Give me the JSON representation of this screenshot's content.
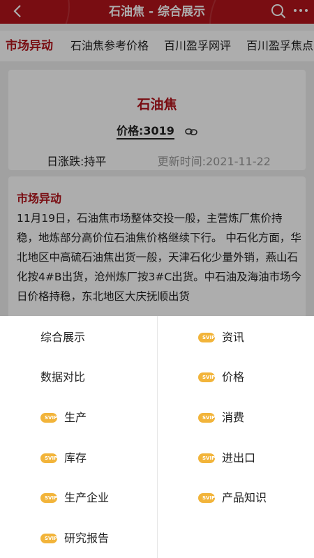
{
  "header": {
    "title": "石油焦 - 综合展示",
    "back_icon": "chevron-left-icon",
    "search_icon": "search-icon",
    "more_icon": "more-dots-icon",
    "brand_color": "#b3141b"
  },
  "tabs": [
    {
      "label": "市场异动",
      "active": true
    },
    {
      "label": "石油焦参考价格"
    },
    {
      "label": "百川盈孚网评"
    },
    {
      "label": "百川盈孚焦点"
    }
  ],
  "summary": {
    "product": "石油焦",
    "price_label": "价格:3019",
    "change": "日涨跌:持平",
    "updated": "更新时间:2021-11-22",
    "link_icon": "link-icon"
  },
  "market": {
    "title": "市场异动",
    "body": "11月19日，石油焦市场整体交投一般，主营炼厂焦价持稳，地炼部分高价位石油焦价格继续下行。 中石化方面，华北地区中高硫石油焦出货一般，天津石化少量外销，燕山石化按4#B出货，沧州炼厂按3#C出货。中石油及海油市场今日价格持稳，东北地区大庆抚顺出货"
  },
  "menu": {
    "vip_badge": "SVIP",
    "left": [
      {
        "label": "综合展示",
        "vip": false
      },
      {
        "label": "数据对比",
        "vip": false
      },
      {
        "label": "生产",
        "vip": true
      },
      {
        "label": "库存",
        "vip": true
      },
      {
        "label": "生产企业",
        "vip": true
      },
      {
        "label": "研究报告",
        "vip": true
      }
    ],
    "right": [
      {
        "label": "资讯",
        "vip": true
      },
      {
        "label": "价格",
        "vip": true
      },
      {
        "label": "消费",
        "vip": true
      },
      {
        "label": "进出口",
        "vip": true
      },
      {
        "label": "产品知识",
        "vip": true
      }
    ]
  }
}
